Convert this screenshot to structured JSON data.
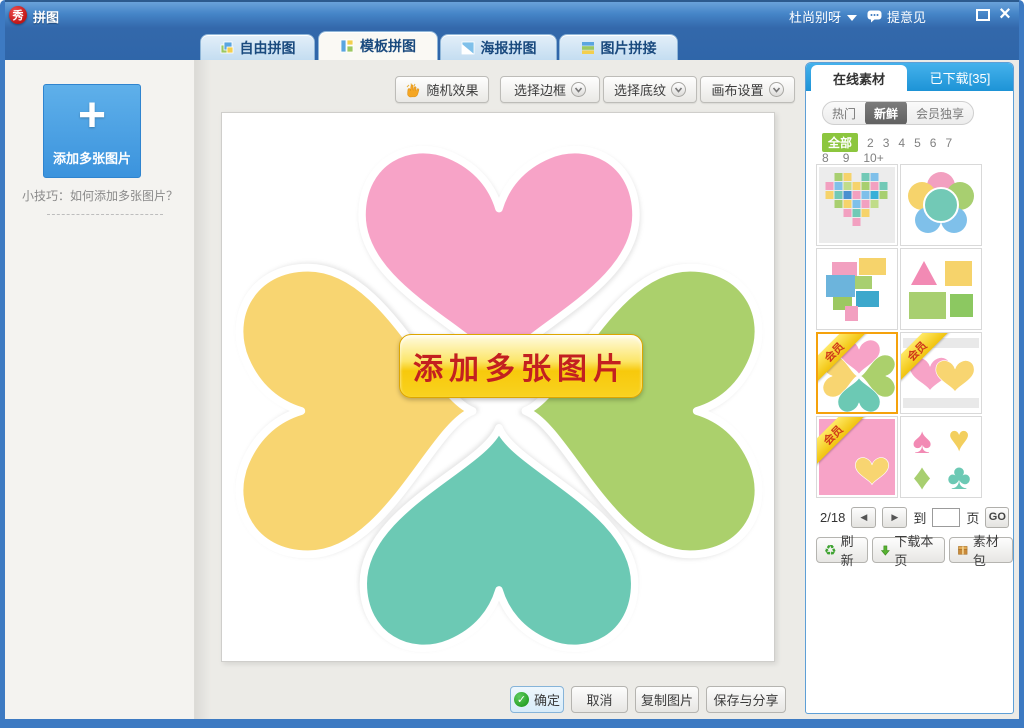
{
  "titlebar": {
    "logo_glyph": "秀",
    "app_title": "拼图",
    "user_name": "杜尚别呀",
    "feedback_label": "提意见",
    "close_glyph": "×"
  },
  "tabs": [
    {
      "label": "自由拼图",
      "active": false
    },
    {
      "label": "模板拼图",
      "active": true
    },
    {
      "label": "海报拼图",
      "active": false
    },
    {
      "label": "图片拼接",
      "active": false
    }
  ],
  "toolbar": {
    "random_label": "随机效果",
    "border_label": "选择边框",
    "texture_label": "选择底纹",
    "canvas_label": "画布设置"
  },
  "sidebar": {
    "add_plus_glyph": "+",
    "add_button_label": "添加多张图片",
    "tip_text": "小技巧：如何添加多张图片？"
  },
  "canvas": {
    "add_button_label": "添加多张图片"
  },
  "panel": {
    "tab_online": "在线素材",
    "tab_downloaded": "已下载[35]",
    "filters": [
      "热门",
      "新鲜",
      "会员独享"
    ],
    "filter_active": "新鲜",
    "counts": [
      "全部",
      "2",
      "3",
      "4",
      "5",
      "6",
      "7",
      "8",
      "9",
      "10+"
    ],
    "count_active": "全部",
    "ribbon_label": "会员",
    "thumbnails": [
      {
        "design": "mosaic-heart",
        "member": false,
        "selected": false
      },
      {
        "design": "circle-flower",
        "member": false,
        "selected": false
      },
      {
        "design": "scattered-photos",
        "member": false,
        "selected": false
      },
      {
        "design": "geometric-shapes",
        "member": false,
        "selected": false
      },
      {
        "design": "clover-hearts",
        "member": true,
        "selected": true
      },
      {
        "design": "double-hearts",
        "member": true,
        "selected": false
      },
      {
        "design": "heart-corner-card",
        "member": true,
        "selected": false
      },
      {
        "design": "card-suits",
        "member": false,
        "selected": false
      }
    ],
    "pagination": {
      "current": "2/18",
      "prev_glyph": "◀",
      "next_glyph": "▶",
      "goto_label": "到",
      "input_value": "",
      "page_label": "页",
      "go_label": "GO"
    },
    "footer": {
      "refresh_label": "刷新",
      "refresh_glyph": "♻",
      "download_label": "下载本页",
      "pack_label": "素材包"
    }
  },
  "footer_buttons": {
    "ok": "确定",
    "ok_glyph": "✓",
    "cancel": "取消",
    "copy": "复制图片",
    "save": "保存与分享"
  },
  "suits_glyphs": {
    "spade": "♠",
    "heart": "♥",
    "diamond": "♦",
    "club": "♣"
  },
  "colors": {
    "heart_pink": "#f7a3c7",
    "heart_yellow": "#f8d571",
    "heart_green": "#abd06c",
    "heart_teal": "#6cc9b4",
    "accent_blue": "#2f8ad6",
    "selected_orange": "#f5a20c",
    "member_green": "#8cc63e",
    "gold_button": "#f7c90c",
    "button_text_red": "#c32020"
  }
}
